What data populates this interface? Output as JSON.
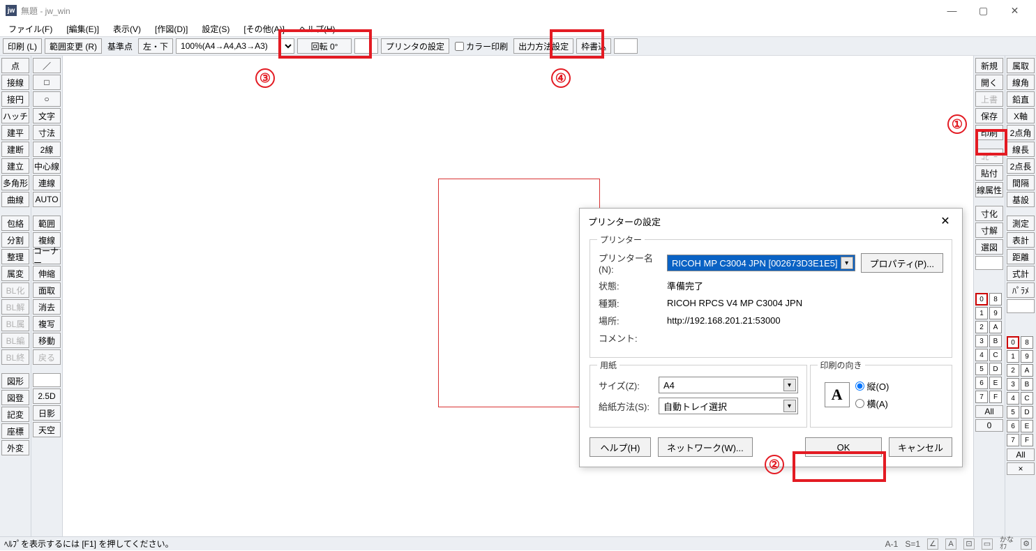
{
  "title": "無題 - jw_win",
  "app_icon": "jw",
  "menu": [
    "ファイル(F)",
    "[編集(E)]",
    "表示(V)",
    "[作図(D)]",
    "設定(S)",
    "[その他(A)]",
    "ヘルプ(H)"
  ],
  "toolbar": {
    "print": "印刷 (L)",
    "range": "範囲変更 (R)",
    "base_lbl": "基準点",
    "base_val": "左・下",
    "scale": "100%(A4→A4,A3→A3)",
    "rotate": "回転  0°",
    "printer_setting": "プリンタの設定",
    "color_print": "カラー印刷",
    "output": "出力方法設定",
    "frame": "枠書込"
  },
  "left_col1": [
    "点",
    "接線",
    "接円",
    "ハッチ",
    "建平",
    "建断",
    "建立",
    "多角形",
    "曲線",
    "",
    "包絡",
    "分割",
    "整理",
    "属変",
    "BL化",
    "BL解",
    "BL属",
    "BL編",
    "BL終",
    "",
    "図形",
    "図登",
    "記変",
    "座標",
    "外変"
  ],
  "left_col1_disabled": [
    14,
    15,
    16,
    17,
    18
  ],
  "left_col2": [
    "／",
    "□",
    "○",
    "文字",
    "寸法",
    "2線",
    "中心線",
    "連線",
    "AUTO",
    "",
    "範囲",
    "複線",
    "コーナー",
    "伸縮",
    "面取",
    "消去",
    "複写",
    "移動",
    "戻る",
    "",
    "",
    "2.5D",
    "日影",
    "天空"
  ],
  "left_col2_disabled": [
    18
  ],
  "right_col1": [
    "新規",
    "開く",
    "上書",
    "保存",
    "印刷",
    "",
    "ｺﾋﾟｰ",
    "貼付",
    "線属性",
    "",
    "寸化",
    "寸解",
    "選図"
  ],
  "right_col1_disabled": [
    2,
    6
  ],
  "right_col2": [
    "属取",
    "線角",
    "鉛直",
    "X軸",
    "2点角",
    "線長",
    "2点長",
    "間隔",
    "基設",
    "",
    "測定",
    "表計",
    "距離",
    "式計",
    "ﾊﾟﾗﾒ"
  ],
  "layer_rows_left": [
    [
      "0",
      "8"
    ],
    [
      "1",
      "9"
    ],
    [
      "2",
      "A"
    ],
    [
      "3",
      "B"
    ],
    [
      "4",
      "C"
    ],
    [
      "5",
      "D"
    ],
    [
      "6",
      "E"
    ],
    [
      "7",
      "F"
    ]
  ],
  "layer_rows_right": [
    [
      "0",
      "8"
    ],
    [
      "1",
      "9"
    ],
    [
      "2",
      "A"
    ],
    [
      "3",
      "B"
    ],
    [
      "4",
      "C"
    ],
    [
      "5",
      "D"
    ],
    [
      "6",
      "E"
    ],
    [
      "7",
      "F"
    ]
  ],
  "layer_all": "All",
  "layer_zero": "0",
  "layer_x": "×",
  "dialog": {
    "title": "プリンターの設定",
    "printer_group": "プリンター",
    "name_lbl": "プリンター名(N):",
    "name_val": "RICOH MP C3004 JPN [002673D3E1E5]",
    "prop_btn": "プロパティ(P)...",
    "status_lbl": "状態:",
    "status_val": "準備完了",
    "type_lbl": "種類:",
    "type_val": "RICOH RPCS V4 MP C3004 JPN",
    "where_lbl": "場所:",
    "where_val": "http://192.168.201.21:53000",
    "comment_lbl": "コメント:",
    "paper_group": "用紙",
    "size_lbl": "サイズ(Z):",
    "size_val": "A4",
    "source_lbl": "給紙方法(S):",
    "source_val": "自動トレイ選択",
    "orient_group": "印刷の向き",
    "orient_icon": "A",
    "orient_portrait": "縦(O)",
    "orient_landscape": "横(A)",
    "help_btn": "ヘルプ(H)",
    "network_btn": "ネットワーク(W)...",
    "ok_btn": "OK",
    "cancel_btn": "キャンセル"
  },
  "status": {
    "hint": "ﾍﾙﾌﾟを表示するには [F1] を押してください。",
    "a1": "A-1",
    "s1": "S=1"
  },
  "annotations": {
    "1": "①",
    "2": "②",
    "3": "③",
    "4": "④"
  }
}
